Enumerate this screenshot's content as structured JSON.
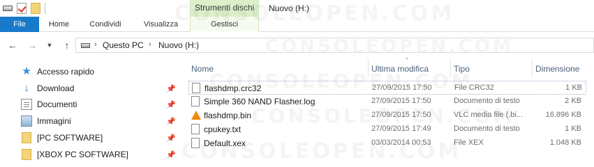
{
  "window": {
    "title": "Nuovo (H:)",
    "context_tab_group": "Strumenti dischi"
  },
  "ribbon": {
    "tabs": [
      "File",
      "Home",
      "Condividi",
      "Visualizza",
      "Gestisci"
    ],
    "colors": {
      "file_tab": "#1979ca",
      "context_group": "#dcefc8"
    }
  },
  "address": {
    "crumbs": [
      "Questo PC",
      "Nuovo (H:)"
    ]
  },
  "nav_pane": {
    "items": [
      {
        "label": "Accesso rapido",
        "icon": "star-icon",
        "pinned": false
      },
      {
        "label": "Download",
        "icon": "download-icon",
        "pinned": true
      },
      {
        "label": "Documenti",
        "icon": "documents-icon",
        "pinned": true
      },
      {
        "label": "Immagini",
        "icon": "pictures-icon",
        "pinned": true
      },
      {
        "label": "[PC SOFTWARE]",
        "icon": "folder-icon",
        "pinned": true
      },
      {
        "label": "[XBOX PC SOFTWARE]",
        "icon": "folder-icon",
        "pinned": true
      }
    ]
  },
  "file_list": {
    "columns": [
      "Nome",
      "Ultima modifica",
      "Tipo",
      "Dimensione"
    ],
    "files": [
      {
        "name": "flashdmp.crc32",
        "modified": "27/09/2015 17:50",
        "type": "File CRC32",
        "size": "1 KB",
        "icon": "file-icon"
      },
      {
        "name": "Simple 360 NAND Flasher.log",
        "modified": "27/09/2015 17:50",
        "type": "Documento di testo",
        "size": "2 KB",
        "icon": "text-file-icon"
      },
      {
        "name": "flashdmp.bin",
        "modified": "27/09/2015 17:50",
        "type": "VLC media file (.bi...",
        "size": "16.896 KB",
        "icon": "vlc-icon"
      },
      {
        "name": "cpukey.txt",
        "modified": "27/09/2015 17:49",
        "type": "Documento di testo",
        "size": "1 KB",
        "icon": "text-file-icon"
      },
      {
        "name": "Default.xex",
        "modified": "03/03/2014 00:53",
        "type": "File XEX",
        "size": "1.048 KB",
        "icon": "file-icon"
      }
    ]
  },
  "watermark": "CONSOLEOPEN.COM"
}
